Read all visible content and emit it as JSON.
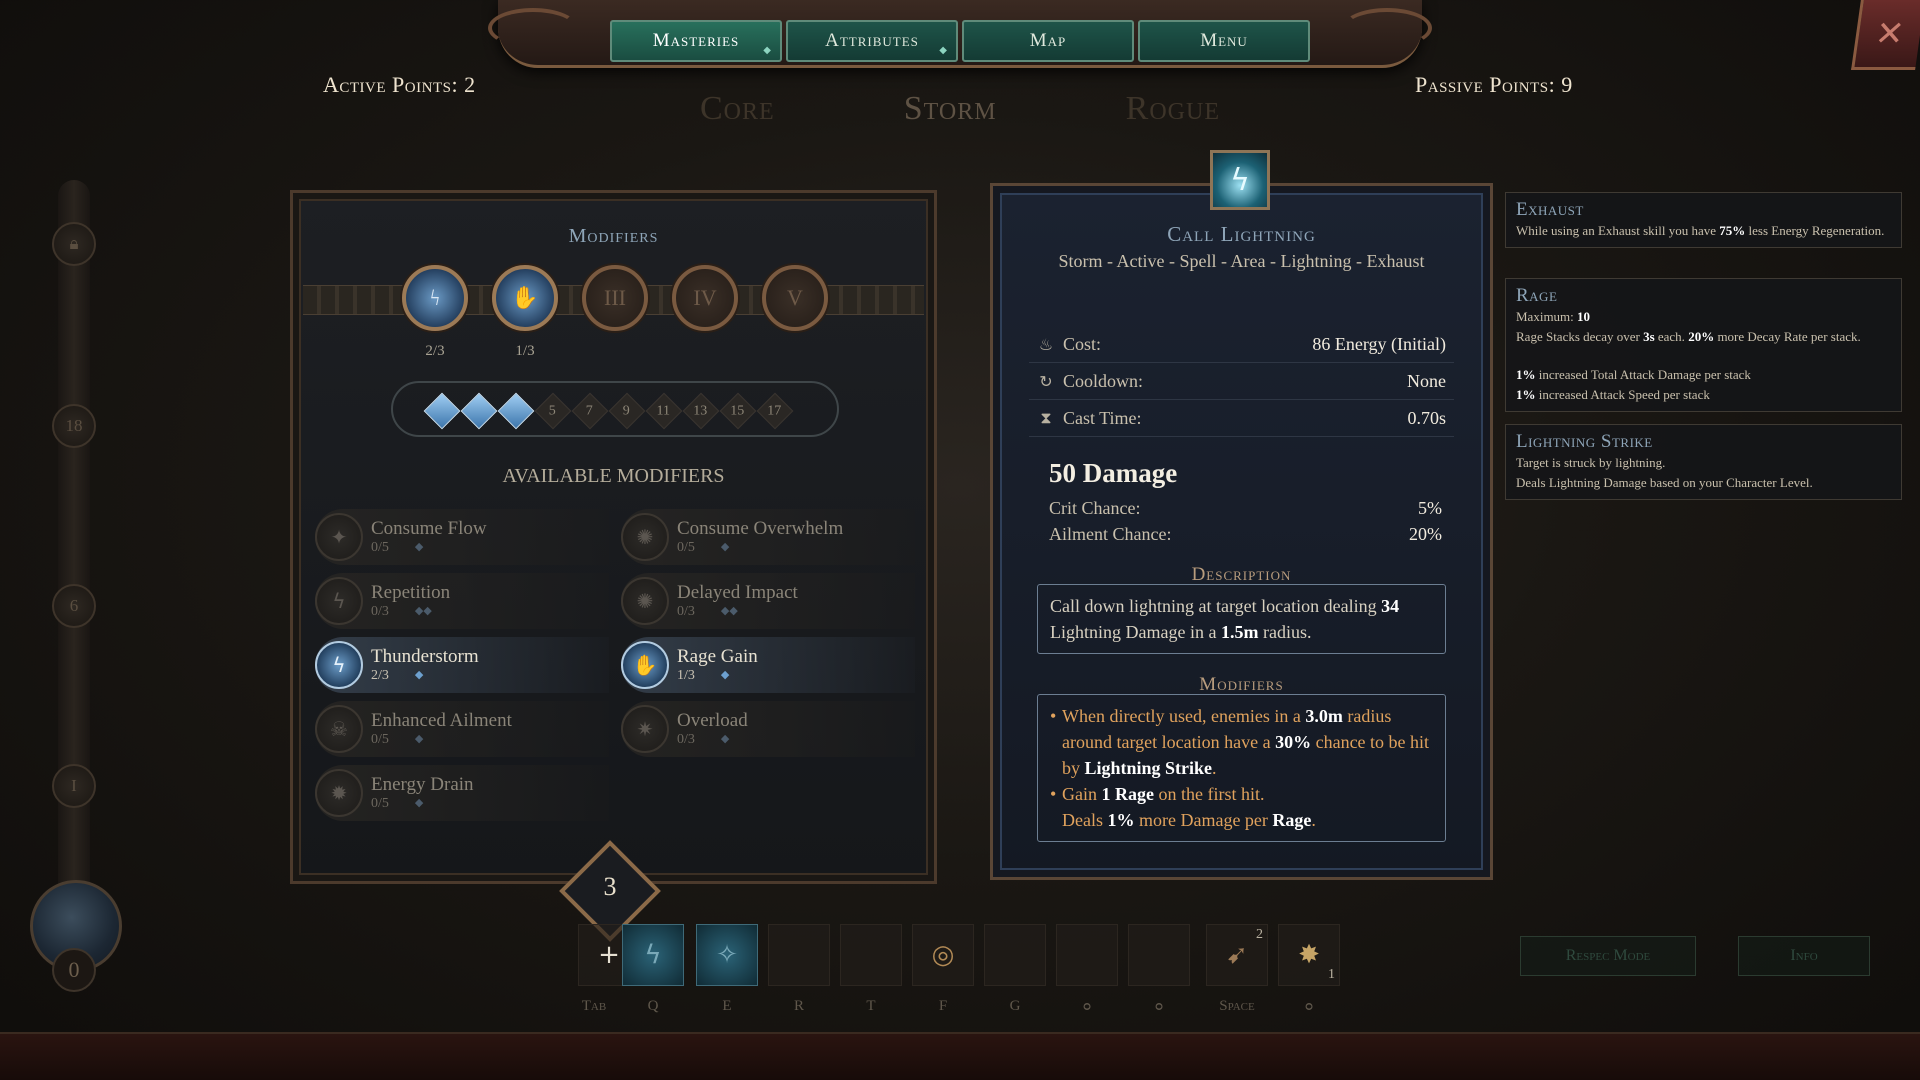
{
  "nav": {
    "tabs": [
      {
        "label": "Masteries",
        "active": true,
        "dot": "◆"
      },
      {
        "label": "Attributes",
        "active": false,
        "dot": "◆"
      },
      {
        "label": "Map",
        "active": false,
        "dot": ""
      },
      {
        "label": "Menu",
        "active": false,
        "dot": ""
      }
    ],
    "close_icon": "✕"
  },
  "points": {
    "active_label": "Active Points:",
    "active_value": "2",
    "passive_label": "Passive Points:",
    "passive_value": "9"
  },
  "mastery_tabs": [
    "Core",
    "Storm",
    "Rogue"
  ],
  "rail": {
    "nodes": [
      "18",
      "6",
      "I"
    ],
    "bottom_value": "0"
  },
  "modifiers_panel": {
    "title": "Modifiers",
    "medals": [
      {
        "label": "",
        "count": "2/3",
        "filled": true,
        "icon": "thunderstorm-icon"
      },
      {
        "label": "",
        "count": "1/3",
        "filled": true,
        "icon": "rage-gain-icon"
      },
      {
        "label": "III",
        "count": "",
        "filled": false
      },
      {
        "label": "IV",
        "count": "",
        "filled": false
      },
      {
        "label": "V",
        "count": "",
        "filled": false
      }
    ],
    "pips": [
      {
        "label": "",
        "filled": true
      },
      {
        "label": "",
        "filled": true
      },
      {
        "label": "",
        "filled": true
      },
      {
        "label": "5",
        "filled": false
      },
      {
        "label": "7",
        "filled": false
      },
      {
        "label": "9",
        "filled": false
      },
      {
        "label": "11",
        "filled": false
      },
      {
        "label": "13",
        "filled": false
      },
      {
        "label": "15",
        "filled": false
      },
      {
        "label": "17",
        "filled": false
      }
    ],
    "available_title": "AVAILABLE MODIFIERS",
    "modifiers": [
      {
        "name": "Consume Flow",
        "count": "0/5",
        "active": false,
        "icon": "✦"
      },
      {
        "name": "Consume Overwhelm",
        "count": "0/5",
        "active": false,
        "icon": "✺"
      },
      {
        "name": "Repetition",
        "count": "0/3",
        "active": false,
        "icon": "ϟ",
        "diams": "◆◆"
      },
      {
        "name": "Delayed Impact",
        "count": "0/3",
        "active": false,
        "icon": "✺",
        "diams": "◆◆"
      },
      {
        "name": "Thunderstorm",
        "count": "2/3",
        "active": true,
        "icon": "ϟ"
      },
      {
        "name": "Rage Gain",
        "count": "1/3",
        "active": true,
        "icon": "✋"
      },
      {
        "name": "Enhanced Ailment",
        "count": "0/5",
        "active": false,
        "icon": "☠"
      },
      {
        "name": "Overload",
        "count": "0/3",
        "active": false,
        "icon": "✷"
      },
      {
        "name": "Energy Drain",
        "count": "0/5",
        "active": false,
        "icon": "✹"
      }
    ],
    "points_badge": "3"
  },
  "detail": {
    "title": "Call Lightning",
    "tags": "Storm - Active - Spell - Area - Lightning - Exhaust",
    "stats": [
      {
        "label": "Cost:",
        "value": "86 Energy (Initial)",
        "icon": "♨"
      },
      {
        "label": "Cooldown:",
        "value": "None",
        "icon": "↻"
      },
      {
        "label": "Cast Time:",
        "value": "0.70s",
        "icon": "⧗"
      }
    ],
    "damage": "50 Damage",
    "sub_stats": [
      {
        "label": "Crit Chance:",
        "value": "5%"
      },
      {
        "label": "Ailment Chance:",
        "value": "20%"
      }
    ],
    "description_title": "Description",
    "description_parts": [
      "Call down lightning at target location dealing ",
      "34",
      " Lightning Damage in a ",
      "1.5m",
      " radius."
    ],
    "modifiers_title": "Modifiers",
    "mod1": [
      "When directly used, enemies in a ",
      "3.0m",
      " radius around target location have a ",
      "30%",
      " chance to be hit by ",
      "Lightning Strike",
      "."
    ],
    "mod2": [
      "Gain ",
      "1 Rage",
      " on the first hit.",
      "Deals ",
      "1%",
      " more Damage per ",
      "Rage",
      "."
    ]
  },
  "tooltips": [
    {
      "title": "Exhaust",
      "lines": [
        [
          "While using an Exhaust skill you have ",
          "75%",
          " less Energy Regeneration."
        ]
      ]
    },
    {
      "title": "Rage",
      "lines": [
        [
          "Maximum: ",
          "10",
          ""
        ],
        [
          "Rage Stacks decay over ",
          "3s",
          " each. ",
          "20%",
          " more Decay Rate per stack."
        ],
        [
          "",
          "",
          ""
        ],
        [
          "",
          "1%",
          " increased Total Attack Damage per stack"
        ],
        [
          "",
          "1%",
          " increased Attack Speed per stack"
        ]
      ]
    },
    {
      "title": "Lightning Strike",
      "lines": [
        [
          "Target is struck by lightning.",
          "",
          ""
        ],
        [
          "Deals Lightning Damage based on your Character Level.",
          "",
          ""
        ]
      ]
    }
  ],
  "hotbar": {
    "keys": [
      "Tab",
      "Q",
      "E",
      "R",
      "T",
      "F",
      "G",
      "",
      "",
      "Space",
      ""
    ],
    "slot_plus": "+",
    "slot_numbers": [
      "2",
      "1"
    ],
    "buttons": [
      "Respec Mode",
      "Info"
    ]
  }
}
